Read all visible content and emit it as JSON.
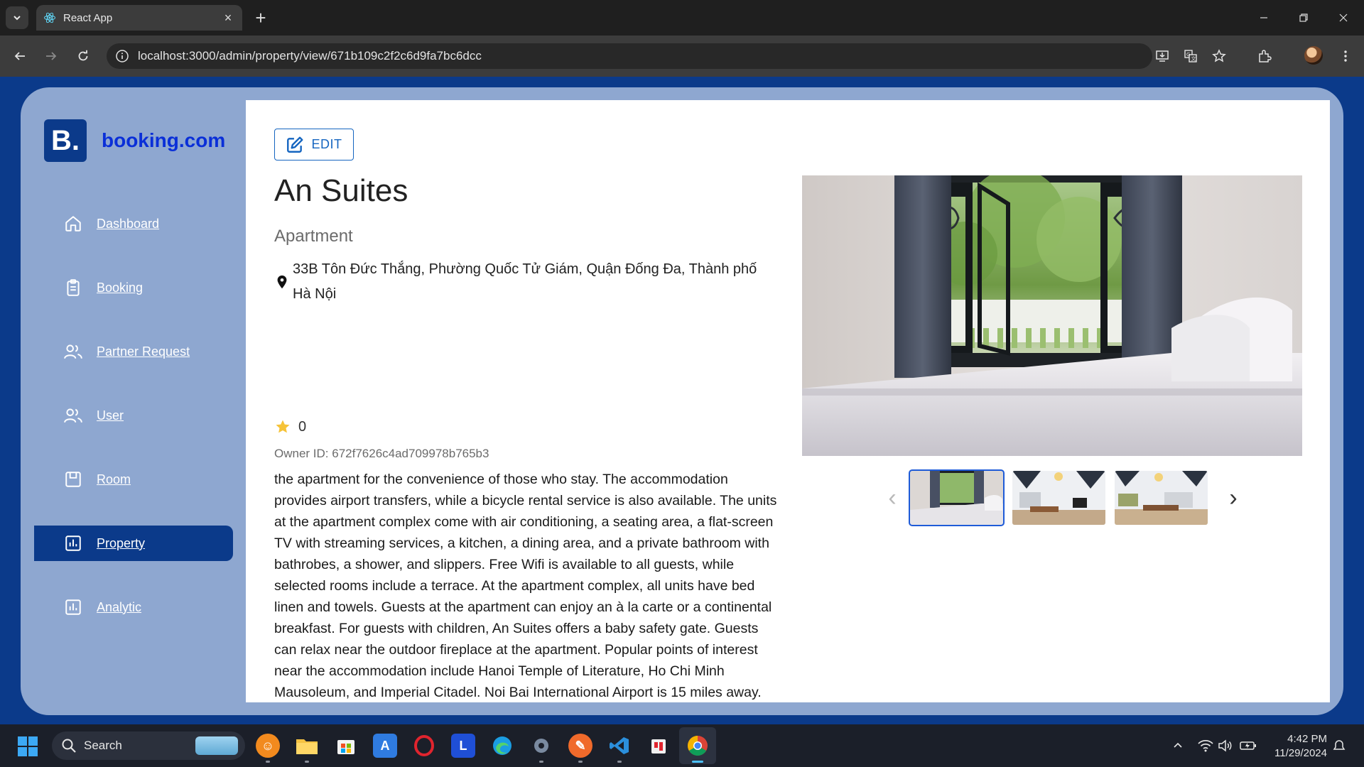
{
  "browser": {
    "tab_title": "React App",
    "url": "localhost:3000/admin/property/view/671b109c2f2c6d9fa7bc6dcc"
  },
  "brand": {
    "logo_text": "B.",
    "name": "booking.com"
  },
  "sidebar": {
    "items": [
      {
        "label": "Dashboard",
        "icon": "home-icon"
      },
      {
        "label": "Booking",
        "icon": "clipboard-icon"
      },
      {
        "label": "Partner Request",
        "icon": "users-icon"
      },
      {
        "label": "User",
        "icon": "users-icon"
      },
      {
        "label": "Room",
        "icon": "room-icon"
      },
      {
        "label": "Property",
        "icon": "chart-icon",
        "active": true
      },
      {
        "label": "Analytic",
        "icon": "chart-icon"
      }
    ]
  },
  "property": {
    "edit_label": "EDIT",
    "name": "An Suites",
    "type": "Apartment",
    "address": "33B Tôn Đức Thắng, Phường Quốc Tử Giám, Quận Đống Đa, Thành phố Hà Nội",
    "rating": "0",
    "owner": "Owner ID: 672f7626c4ad709978b765b3",
    "description": "the apartment for the convenience of those who stay. The accommodation provides airport transfers, while a bicycle rental service is also available. The units at the apartment complex come with air conditioning, a seating area, a flat-screen TV with streaming services, a kitchen, a dining area, and a private bathroom with bathrobes, a shower, and slippers. Free Wifi is available to all guests, while selected rooms include a terrace. At the apartment complex, all units have bed linen and towels. Guests at the apartment can enjoy an à la carte or a continental breakfast. For guests with children, An Suites offers a baby safety gate. Guests can relax near the outdoor fireplace at the apartment. Popular points of interest near the accommodation include Hanoi Temple of Literature, Ho Chi Minh Mausoleum, and Imperial Citadel. Noi Bai International Airport is 15 miles away."
  },
  "gallery": {
    "selected_index": 0,
    "thumbnail_count": 3
  },
  "taskbar": {
    "search_placeholder": "Search",
    "time": "4:42 PM",
    "date": "11/29/2024"
  },
  "colors": {
    "brand_blue": "#0b3a8a",
    "sidebar_bg": "#8ea7d0",
    "accent": "#1565c0",
    "star": "#f6c338"
  }
}
